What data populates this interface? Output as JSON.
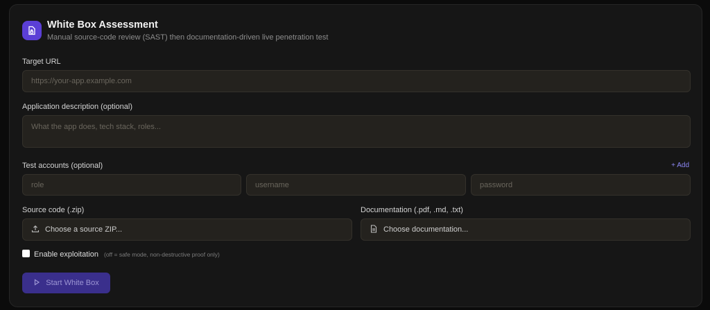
{
  "header": {
    "title": "White Box Assessment",
    "subtitle": "Manual source-code review (SAST) then documentation-driven live penetration test",
    "icon": "document-lock-icon",
    "accent": "#5b3fd6"
  },
  "target_url": {
    "label": "Target URL",
    "placeholder": "https://your-app.example.com",
    "value": ""
  },
  "description": {
    "label": "Application description (optional)",
    "placeholder": "What the app does, tech stack, roles...",
    "value": ""
  },
  "test_accounts": {
    "label": "Test accounts (optional)",
    "add_label": "+ Add",
    "role_placeholder": "role",
    "username_placeholder": "username",
    "password_placeholder": "password"
  },
  "source_code": {
    "label": "Source code (.zip)",
    "button_label": "Choose a source ZIP...",
    "icon": "upload-icon"
  },
  "documentation": {
    "label": "Documentation (.pdf, .md, .txt)",
    "button_label": "Choose documentation...",
    "icon": "document-icon"
  },
  "exploitation": {
    "label": "Enable exploitation",
    "hint": "(off = safe mode, non-destructive proof only)",
    "checked": false
  },
  "start_button": {
    "label": "Start White Box",
    "icon": "play-icon"
  }
}
